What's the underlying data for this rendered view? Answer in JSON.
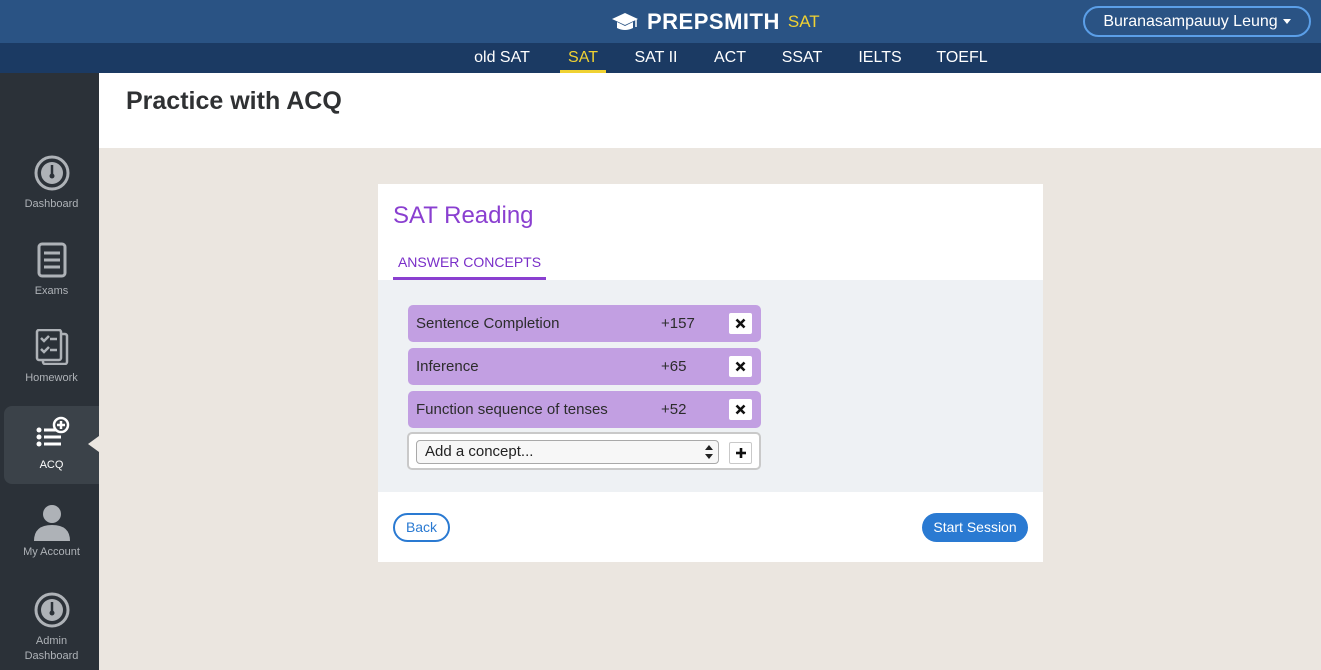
{
  "brand": {
    "name": "PREPSMITH",
    "sub": "SAT"
  },
  "user": {
    "name": "Buranasampauuy Leung"
  },
  "exam_tabs": [
    {
      "label": "old SAT",
      "active": false
    },
    {
      "label": "SAT",
      "active": true
    },
    {
      "label": "SAT II",
      "active": false
    },
    {
      "label": "ACT",
      "active": false
    },
    {
      "label": "SSAT",
      "active": false
    },
    {
      "label": "IELTS",
      "active": false
    },
    {
      "label": "TOEFL",
      "active": false
    }
  ],
  "sidebar": {
    "items": [
      {
        "label": "Dashboard",
        "icon": "gauge-icon"
      },
      {
        "label": "Exams",
        "icon": "exam-list-icon"
      },
      {
        "label": "Homework",
        "icon": "homework-checklist-icon"
      },
      {
        "label": "ACQ",
        "icon": "list-add-icon",
        "active": true
      },
      {
        "label": "My Account",
        "icon": "user-icon"
      },
      {
        "label": "Admin Dashboard",
        "icon": "gauge-icon"
      }
    ]
  },
  "page": {
    "title": "Practice with ACQ"
  },
  "card": {
    "title": "SAT Reading",
    "tab_label": "ANSWER CONCEPTS",
    "concepts": [
      {
        "name": "Sentence Completion",
        "value": "+157"
      },
      {
        "name": "Inference",
        "value": "+65"
      },
      {
        "name": "Function sequence of tenses",
        "value": "+52"
      }
    ],
    "add_concept_placeholder": "Add a concept...",
    "back_label": "Back",
    "start_label": "Start Session"
  },
  "colors": {
    "topbar": "#2a5384",
    "examnav": "#1b3a63",
    "accent_yellow": "#f0d232",
    "purple": "#8a3fd0",
    "concept_bg": "#c29fe2",
    "button_blue": "#2a7ad2"
  }
}
